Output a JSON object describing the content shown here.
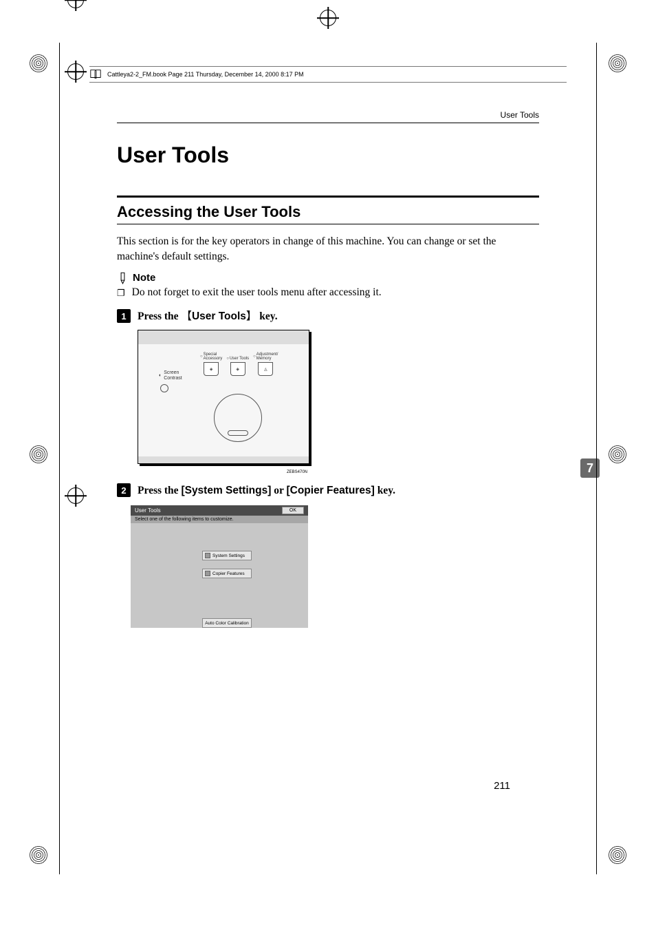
{
  "running_head": "Cattleya2-2_FM.book  Page 211  Thursday, December 14, 2000  8:17 PM",
  "header_right": "User Tools",
  "title": "User Tools",
  "subsection": "Accessing the User Tools",
  "intro": "This section is for the key operators in change of this machine. You can change or set the machine's default settings.",
  "note_label": "Note",
  "note_body": "Do not forget to exit the user tools menu after accessing it.",
  "steps": {
    "s1_pre": "Press the ",
    "s1_key": "User Tools",
    "s1_post": " key.",
    "s2_pre": "Press the ",
    "s2_k1": "[System Settings]",
    "s2_mid": " or ",
    "s2_k2": "[Copier Features]",
    "s2_post": " key."
  },
  "panel": {
    "btn1_top": "Special",
    "btn1_bot": "Accessory",
    "btn2": "User Tools",
    "btn3_top": "Adjustment/",
    "btn3_bot": "Memory",
    "screen_l1": "Screen",
    "screen_l2": "Contrast",
    "fig_id": "ZEBS470N"
  },
  "screenshot": {
    "title": "User Tools",
    "ok": "OK",
    "subtitle": "Select one of the following items to customize.",
    "btn1": "System Settings",
    "btn2": "Copier Features",
    "btn3": "Auto Color Calibration"
  },
  "tab": "7",
  "page_number": "211",
  "square_bullet": "❐"
}
